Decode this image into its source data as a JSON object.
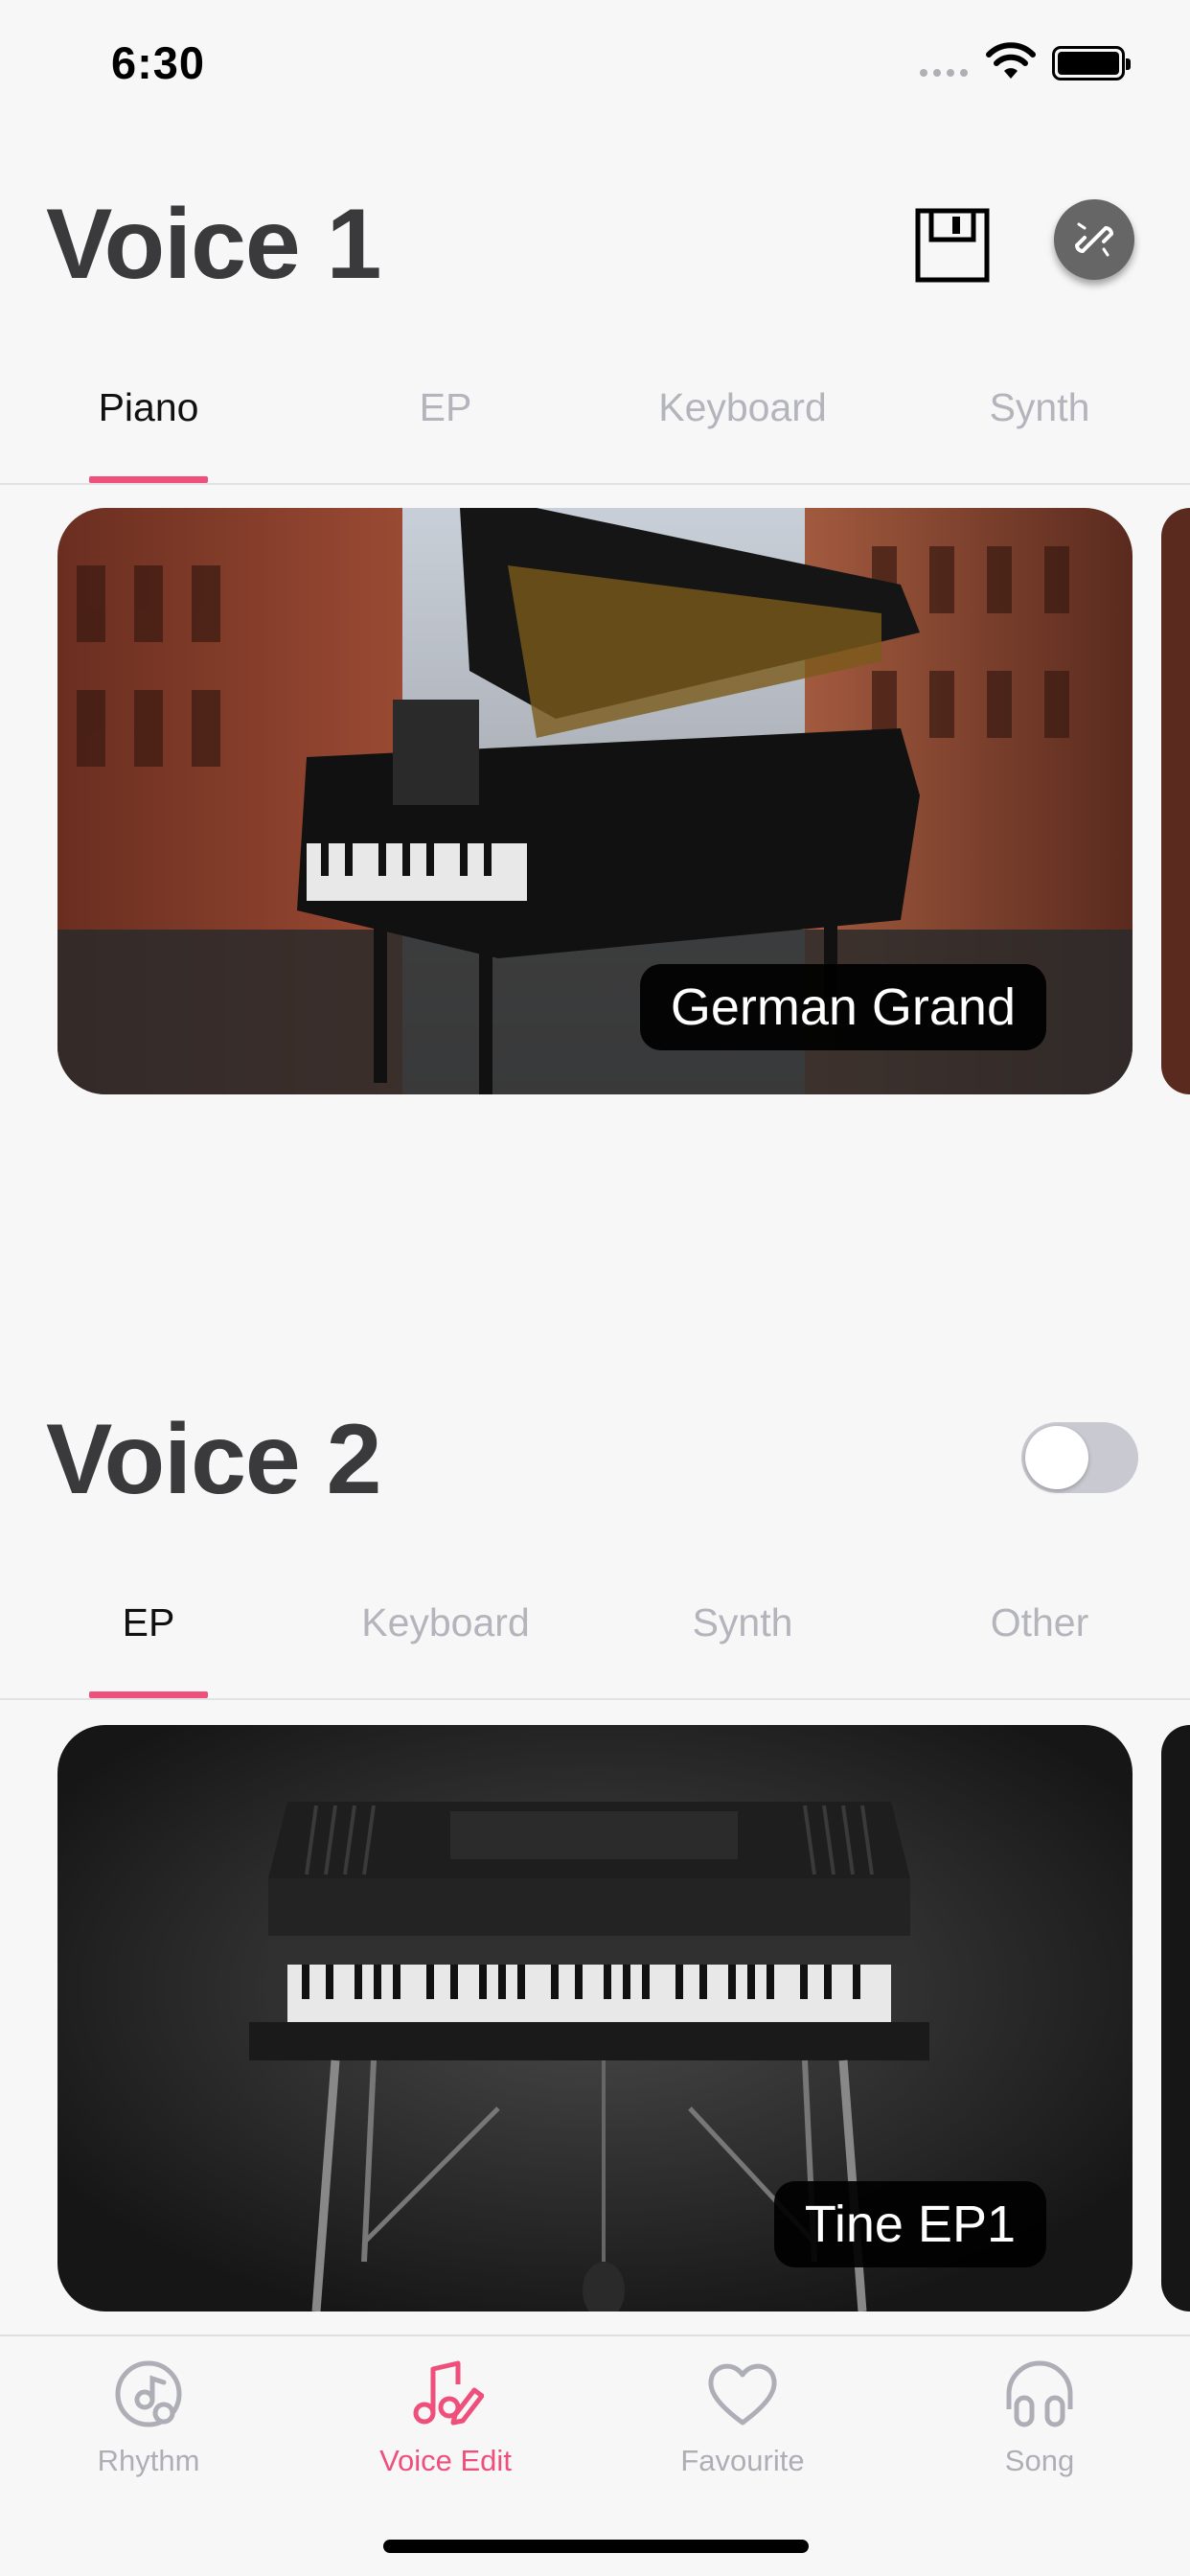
{
  "status_bar": {
    "time": "6:30"
  },
  "voice1": {
    "title": "Voice 1",
    "tabs": [
      "Piano",
      "EP",
      "Keyboard",
      "Synth"
    ],
    "active_tab": "Piano",
    "card_label": "German Grand"
  },
  "voice2": {
    "title": "Voice 2",
    "toggle_on": false,
    "tabs": [
      "EP",
      "Keyboard",
      "Synth",
      "Other"
    ],
    "active_tab": "EP",
    "card_label": "Tine EP1"
  },
  "bottom_nav": {
    "items": [
      {
        "label": "Rhythm",
        "icon": "vinyl-note-icon"
      },
      {
        "label": "Voice Edit",
        "icon": "music-note-pen-icon"
      },
      {
        "label": "Favourite",
        "icon": "heart-icon"
      },
      {
        "label": "Song",
        "icon": "headphones-icon"
      }
    ],
    "active": "Voice Edit"
  },
  "colors": {
    "accent": "#ef4f7b",
    "inactive": "#b4b4bc",
    "title": "#3a3a3c"
  }
}
